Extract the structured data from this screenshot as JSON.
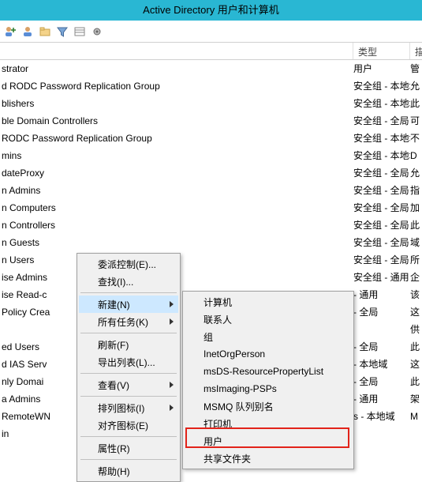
{
  "titlebar": {
    "title": "Active Directory 用户和计算机"
  },
  "toolbar_icons": [
    "user-add",
    "user-icon",
    "folder-icon",
    "funnel-icon",
    "list-icon",
    "gear-icon"
  ],
  "columns": {
    "name": "",
    "type": "类型",
    "desc": "描"
  },
  "rows": [
    {
      "name": "strator",
      "type": "用户",
      "desc": "管"
    },
    {
      "name": "d RODC Password Replication Group",
      "type": "安全组 - 本地域",
      "desc": "允"
    },
    {
      "name": "blishers",
      "type": "安全组 - 本地域",
      "desc": "此"
    },
    {
      "name": "ble Domain Controllers",
      "type": "安全组 - 全局",
      "desc": "可"
    },
    {
      "name": "  RODC Password Replication Group",
      "type": "安全组 - 本地域",
      "desc": "不"
    },
    {
      "name": "mins",
      "type": "安全组 - 本地域",
      "desc": "D"
    },
    {
      "name": "dateProxy",
      "type": "安全组 - 全局",
      "desc": "允"
    },
    {
      "name": "n Admins",
      "type": "安全组 - 全局",
      "desc": "指"
    },
    {
      "name": "n Computers",
      "type": "安全组 - 全局",
      "desc": "加"
    },
    {
      "name": "n Controllers",
      "type": "安全组 - 全局",
      "desc": "此"
    },
    {
      "name": "n Guests",
      "type": "安全组 - 全局",
      "desc": "域"
    },
    {
      "name": "n Users",
      "type": "安全组 - 全局",
      "desc": "所"
    },
    {
      "name": "ise Admins",
      "type": "安全组 - 通用",
      "desc": "企"
    },
    {
      "name": "ise Read-c",
      "type": "- 通用",
      "desc": "该"
    },
    {
      "name": "Policy Crea",
      "type": "- 全局",
      "desc": "这"
    },
    {
      "name": "",
      "type": "",
      "desc": "供"
    },
    {
      "name": "ed Users",
      "type": "- 全局",
      "desc": "此"
    },
    {
      "name": "d IAS Serv",
      "type": "- 本地域",
      "desc": "这"
    },
    {
      "name": "nly Domai",
      "type": "- 全局",
      "desc": "此"
    },
    {
      "name": "a Admins",
      "type": "- 通用",
      "desc": "架"
    },
    {
      "name": "RemoteWN",
      "type": "s - 本地域",
      "desc": "M"
    },
    {
      "name": "in",
      "type": "",
      "desc": ""
    }
  ],
  "menu1": {
    "items": [
      {
        "label": "委派控制(E)...",
        "sub": false
      },
      {
        "label": "查找(I)...",
        "sub": false
      },
      {
        "sep": true
      },
      {
        "label": "新建(N)",
        "sub": true,
        "hover": true
      },
      {
        "label": "所有任务(K)",
        "sub": true
      },
      {
        "sep": true
      },
      {
        "label": "刷新(F)",
        "sub": false
      },
      {
        "label": "导出列表(L)...",
        "sub": false
      },
      {
        "sep": true
      },
      {
        "label": "查看(V)",
        "sub": true
      },
      {
        "sep": true
      },
      {
        "label": "排列图标(I)",
        "sub": true
      },
      {
        "label": "对齐图标(E)",
        "sub": false
      },
      {
        "sep": true
      },
      {
        "label": "属性(R)",
        "sub": false
      },
      {
        "sep": true
      },
      {
        "label": "帮助(H)",
        "sub": false
      }
    ]
  },
  "menu2": {
    "items": [
      {
        "label": "计算机"
      },
      {
        "label": "联系人"
      },
      {
        "label": "组"
      },
      {
        "label": "InetOrgPerson"
      },
      {
        "label": "msDS-ResourcePropertyList"
      },
      {
        "label": "msImaging-PSPs"
      },
      {
        "label": "MSMQ 队列别名"
      },
      {
        "label": "打印机"
      },
      {
        "label": "用户"
      },
      {
        "label": "共享文件夹"
      }
    ]
  }
}
